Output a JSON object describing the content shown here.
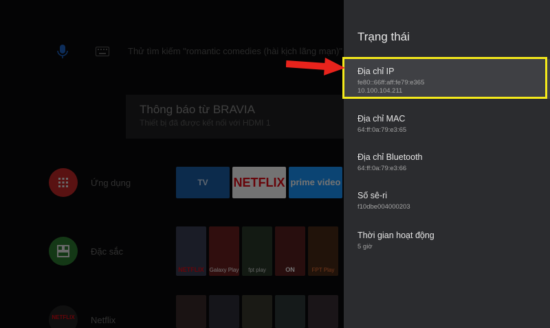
{
  "search": {
    "placeholder": "Thử tìm kiếm \"romantic comedies (hài kịch lãng mạn)\""
  },
  "notification": {
    "title": "Thông báo từ BRAVIA",
    "subtitle": "Thiết bị đã được kết nối với HDMI 1"
  },
  "rows": [
    {
      "label": "Ứng dụng",
      "icon": "apps-grid-icon",
      "color": "#c62828"
    },
    {
      "label": "Đặc sắc",
      "icon": "featured-icon",
      "color": "#2e7d32"
    },
    {
      "label": "Netflix",
      "icon": "netflix-icon",
      "color": "#222222"
    }
  ],
  "apps": [
    {
      "label": "TV",
      "color": "#1b5fa8"
    },
    {
      "label": "NETFLIX",
      "color": "#e50914"
    },
    {
      "label": "prime video",
      "color": "#1a98ff"
    }
  ],
  "featured": [
    "NETFLIX",
    "Galaxy Play",
    "fpt play",
    "ON",
    "FPT Play"
  ],
  "status_panel": {
    "title": "Trạng thái",
    "items": [
      {
        "label": "Địa chỉ IP",
        "values": [
          "fe80::66ff:aff:fe79:e365",
          "10.100.104.211"
        ]
      },
      {
        "label": "Địa chỉ MAC",
        "values": [
          "64:ff:0a:79:e3:65"
        ]
      },
      {
        "label": "Địa chỉ Bluetooth",
        "values": [
          "64:ff:0a:79:e3:66"
        ]
      },
      {
        "label": "Số sê-ri",
        "values": [
          "f10dbe004000203"
        ]
      },
      {
        "label": "Thời gian hoạt động",
        "values": [
          "5 giờ"
        ]
      }
    ]
  },
  "colors": {
    "panel_bg": "#2b2c2f",
    "highlight": "#f5ea1b",
    "arrow": "#e8231c"
  }
}
